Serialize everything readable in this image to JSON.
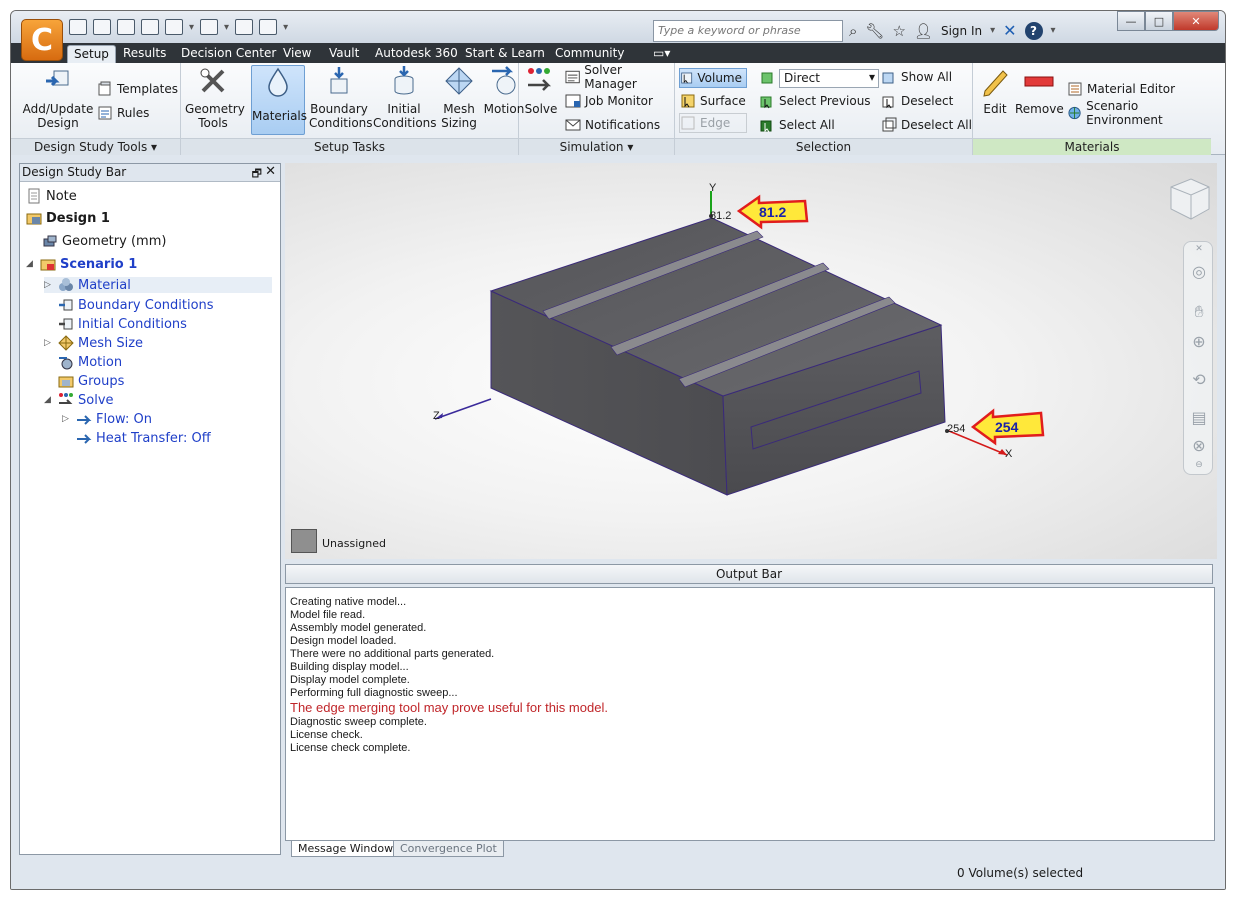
{
  "titlebar": {
    "search_placeholder": "Type a keyword or phrase",
    "sign_in": "Sign In"
  },
  "tabs": [
    "Setup",
    "Results",
    "Decision Center",
    "View",
    "Vault",
    "Autodesk 360",
    "Start & Learn",
    "Community"
  ],
  "ribbon": {
    "design_study_tools": {
      "label": "Design Study Tools ▾",
      "add_update": "Add/Update",
      "design": "Design",
      "templates": "Templates",
      "rules": "Rules"
    },
    "setup_tasks": {
      "label": "Setup Tasks",
      "geometry_tools_1": "Geometry",
      "geometry_tools_2": "Tools",
      "materials": "Materials",
      "boundary_1": "Boundary",
      "boundary_2": "Conditions",
      "initial_1": "Initial",
      "initial_2": "Conditions",
      "mesh_1": "Mesh",
      "mesh_2": "Sizing",
      "motion": "Motion"
    },
    "simulation": {
      "label": "Simulation ▾",
      "solve": "Solve",
      "solver_manager": "Solver Manager",
      "job_monitor": "Job Monitor",
      "notifications": "Notifications"
    },
    "selection": {
      "label": "Selection",
      "volume": "Volume",
      "surface": "Surface",
      "edge": "Edge",
      "direct": "Direct",
      "select_previous": "Select Previous",
      "select_all": "Select All",
      "show_all": "Show All",
      "deselect": "Deselect",
      "deselect_all": "Deselect All"
    },
    "materials": {
      "label": "Materials",
      "edit": "Edit",
      "remove": "Remove",
      "material_editor": "Material Editor",
      "scenario_environment": "Scenario Environment"
    }
  },
  "design_study_bar": {
    "title": "Design Study Bar",
    "items": {
      "note": "Note",
      "design": "Design 1",
      "geometry": "Geometry (mm)",
      "scenario": "Scenario 1",
      "material": "Material",
      "boundary_conditions": "Boundary Conditions",
      "initial_conditions": "Initial Conditions",
      "mesh_size": "Mesh Size",
      "motion": "Motion",
      "groups": "Groups",
      "solve": "Solve",
      "flow": "Flow: On",
      "heat_transfer": "Heat Transfer: Off"
    }
  },
  "viewport": {
    "axis_y_label": "Y",
    "axis_z_label": "Z",
    "axis_x_label": "X",
    "y_value": "81.2",
    "x_value": "254",
    "callout_y": "81.2",
    "callout_x": "254",
    "legend_label": "Unassigned"
  },
  "output": {
    "header": "Output Bar",
    "messages": [
      "Creating native model...",
      "Model file read.",
      "Assembly model generated.",
      "Design model loaded.",
      "There were no additional parts generated.",
      "Building display model...",
      "Display model complete.",
      "Performing full diagnostic sweep...",
      "The edge merging tool may prove useful for this model.",
      "Diagnostic sweep complete.",
      "License check.",
      "License check complete."
    ],
    "tab_message": "Message Window",
    "tab_convergence": "Convergence Plot"
  },
  "status": {
    "selection": "0 Volume(s) selected"
  },
  "colors": {
    "warning": "#c0262a",
    "link": "#1f3fc8",
    "callout_fill": "#ffe83a",
    "callout_border": "#e11d1d",
    "callout_text": "#1a22a8"
  }
}
